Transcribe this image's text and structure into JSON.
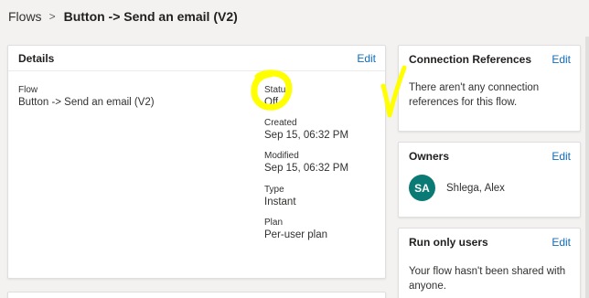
{
  "breadcrumb": {
    "root": "Flows",
    "separator": ">",
    "current": "Button -> Send an email (V2)"
  },
  "details": {
    "title": "Details",
    "edit_label": "Edit",
    "flow_label": "Flow",
    "flow_value": "Button -> Send an email (V2)",
    "status_label": "Status",
    "status_value": "Off",
    "created_label": "Created",
    "created_value": "Sep 15, 06:32 PM",
    "modified_label": "Modified",
    "modified_value": "Sep 15, 06:32 PM",
    "type_label": "Type",
    "type_value": "Instant",
    "plan_label": "Plan",
    "plan_value": "Per-user plan"
  },
  "connection_references": {
    "title": "Connection References",
    "edit_label": "Edit",
    "message": "There aren't any connection references for this flow."
  },
  "owners": {
    "title": "Owners",
    "edit_label": "Edit",
    "avatar_initials": "SA",
    "owner_name": "Shlega, Alex"
  },
  "run_only_users": {
    "title": "Run only users",
    "edit_label": "Edit",
    "message": "Your flow hasn't been shared with anyone."
  },
  "colors": {
    "link": "#0f6cbd",
    "avatar": "#0b7a75",
    "highlight": "#ffff00",
    "background": "#f3f2f1"
  },
  "icons": {
    "breadcrumb_separator": "chevron-right-icon"
  }
}
